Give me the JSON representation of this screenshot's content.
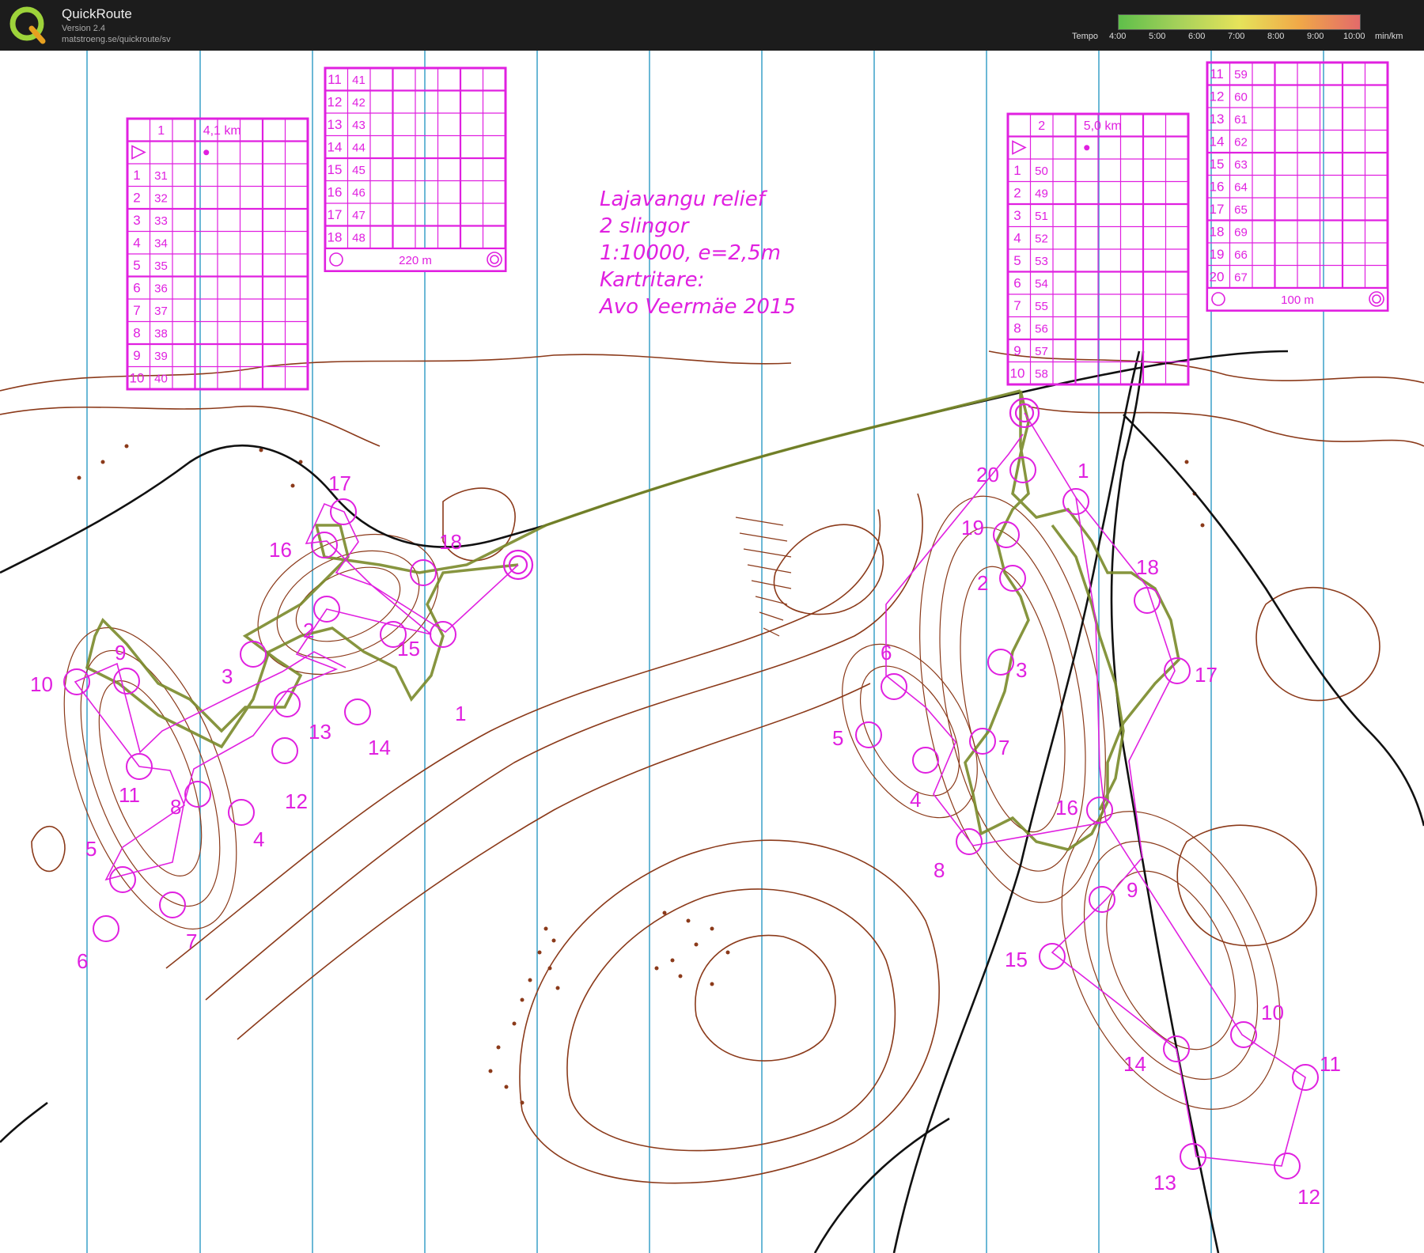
{
  "app": {
    "name": "QuickRoute",
    "version": "Version 2.4",
    "url": "matstroeng.se/quickroute/sv"
  },
  "tempo": {
    "label": "Tempo",
    "ticks": [
      "4:00",
      "5:00",
      "6:00",
      "7:00",
      "8:00",
      "9:00",
      "10:00"
    ],
    "unit": "min/km"
  },
  "map_title": {
    "line1": "Lajavangu relief",
    "line2": "2 slingor",
    "line3": "1:10000, e=2,5m",
    "line4": "Kartritare:",
    "line5": "Avo Veermäe 2015"
  },
  "course1": {
    "number": "1",
    "length": "4,1 km",
    "controls": [
      {
        "n": "1",
        "code": "31"
      },
      {
        "n": "2",
        "code": "32"
      },
      {
        "n": "3",
        "code": "33"
      },
      {
        "n": "4",
        "code": "34"
      },
      {
        "n": "5",
        "code": "35"
      },
      {
        "n": "6",
        "code": "36"
      },
      {
        "n": "7",
        "code": "37"
      },
      {
        "n": "8",
        "code": "38"
      },
      {
        "n": "9",
        "code": "39"
      },
      {
        "n": "10",
        "code": "40"
      },
      {
        "n": "11",
        "code": "41"
      },
      {
        "n": "12",
        "code": "42"
      },
      {
        "n": "13",
        "code": "43"
      },
      {
        "n": "14",
        "code": "44"
      },
      {
        "n": "15",
        "code": "45"
      },
      {
        "n": "16",
        "code": "46"
      },
      {
        "n": "17",
        "code": "47"
      },
      {
        "n": "18",
        "code": "48"
      }
    ],
    "finish_distance": "220 m"
  },
  "course2": {
    "number": "2",
    "length": "5,0 km",
    "controls": [
      {
        "n": "1",
        "code": "50"
      },
      {
        "n": "2",
        "code": "49"
      },
      {
        "n": "3",
        "code": "51"
      },
      {
        "n": "4",
        "code": "52"
      },
      {
        "n": "5",
        "code": "53"
      },
      {
        "n": "6",
        "code": "54"
      },
      {
        "n": "7",
        "code": "55"
      },
      {
        "n": "8",
        "code": "56"
      },
      {
        "n": "9",
        "code": "57"
      },
      {
        "n": "10",
        "code": "58"
      },
      {
        "n": "11",
        "code": "59"
      },
      {
        "n": "12",
        "code": "60"
      },
      {
        "n": "13",
        "code": "61"
      },
      {
        "n": "14",
        "code": "62"
      },
      {
        "n": "15",
        "code": "63"
      },
      {
        "n": "16",
        "code": "64"
      },
      {
        "n": "17",
        "code": "65"
      },
      {
        "n": "18",
        "code": "69"
      },
      {
        "n": "19",
        "code": "66"
      },
      {
        "n": "20",
        "code": "67"
      }
    ],
    "finish_distance": "100 m"
  },
  "map_labels": {
    "c1": [
      "1",
      "2",
      "3",
      "4",
      "5",
      "6",
      "7",
      "8",
      "9",
      "10",
      "11",
      "12",
      "13",
      "14",
      "15",
      "16",
      "17",
      "18"
    ],
    "c2": [
      "1",
      "2",
      "3",
      "4",
      "5",
      "6",
      "7",
      "8",
      "9",
      "10",
      "11",
      "12",
      "13",
      "14",
      "15",
      "16",
      "17",
      "18",
      "19",
      "20"
    ]
  },
  "colors": {
    "overprint": "#e020e0",
    "contour": "#8b3a1a",
    "route": "#7a8a2a",
    "meridian": "#3aa0c8",
    "topbar": "#1c1c1c"
  }
}
